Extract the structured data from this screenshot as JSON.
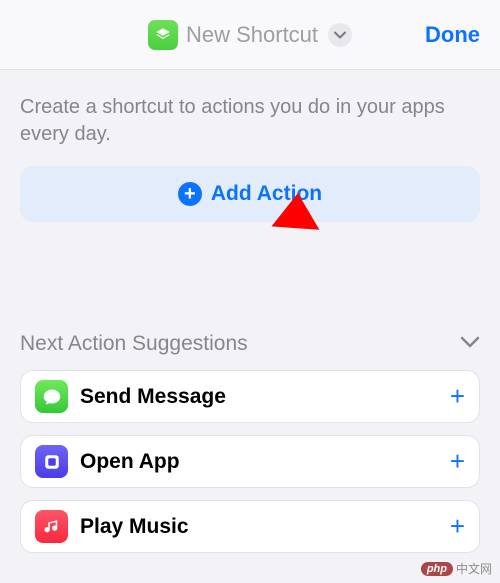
{
  "header": {
    "title": "New Shortcut",
    "done_label": "Done"
  },
  "description": "Create a shortcut to actions you do in your apps every day.",
  "add_action": {
    "label": "Add Action"
  },
  "suggestions": {
    "title": "Next Action Suggestions",
    "items": [
      {
        "label": "Send Message",
        "icon": "messages-icon"
      },
      {
        "label": "Open App",
        "icon": "shortcuts-icon"
      },
      {
        "label": "Play Music",
        "icon": "music-icon"
      }
    ]
  },
  "watermark": {
    "badge": "php",
    "text": "中文网"
  }
}
